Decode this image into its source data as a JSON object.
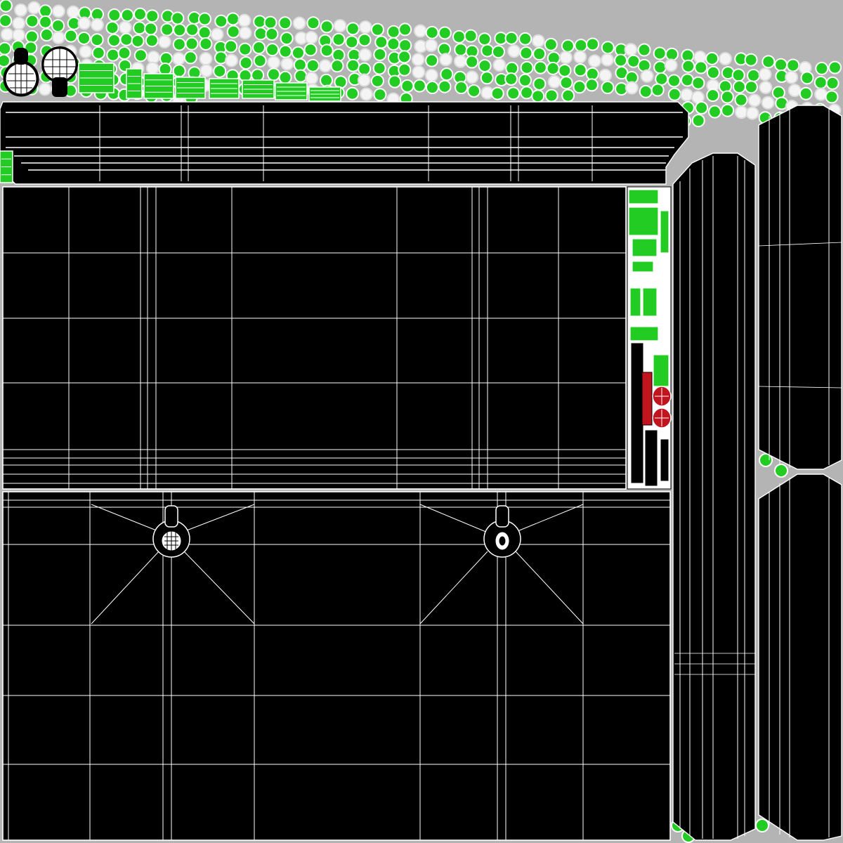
{
  "sheet": {
    "background": "#b4b4b4",
    "island_fill": "#000000",
    "wire_color": "#ffffff",
    "accent_green": "#22cc22",
    "accent_red": "#c0141e"
  }
}
